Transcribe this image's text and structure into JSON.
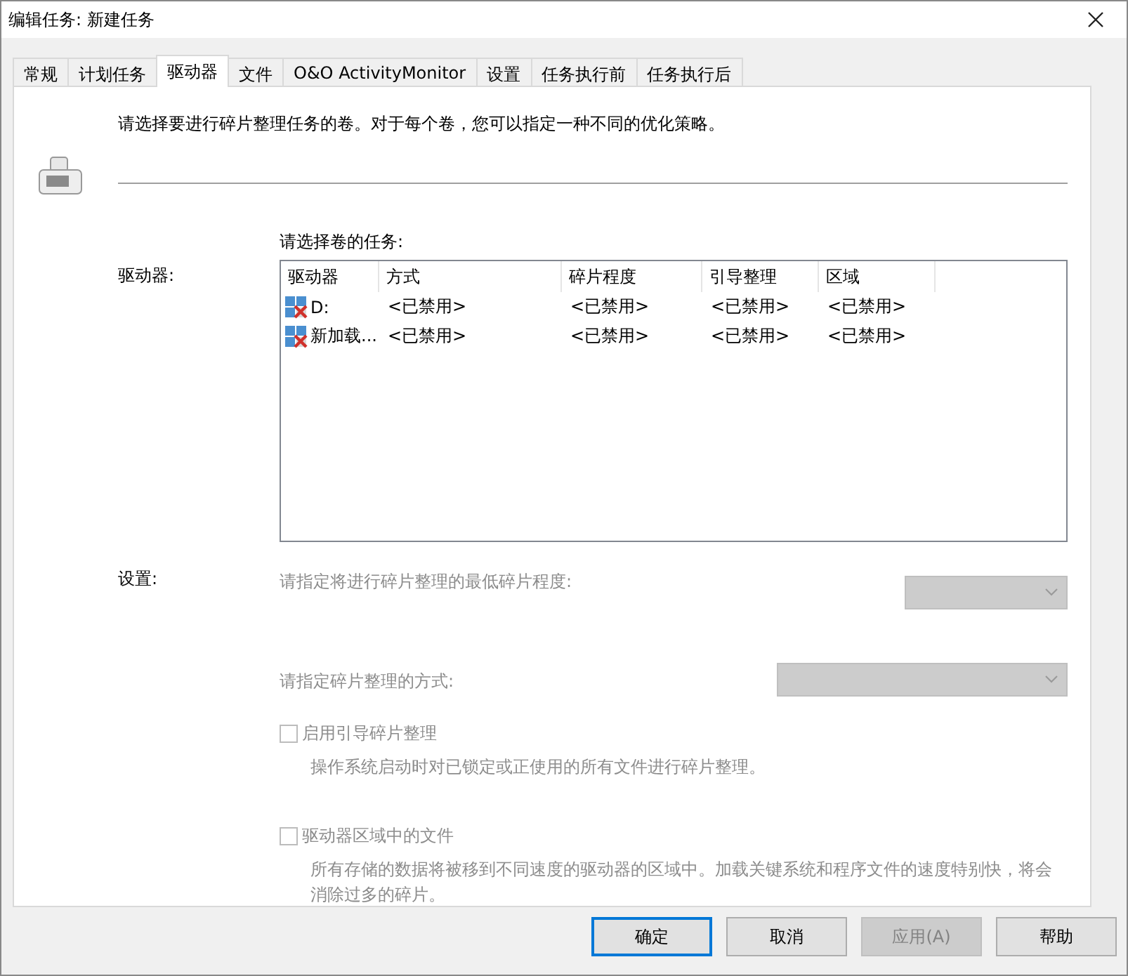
{
  "window": {
    "title": "编辑任务: 新建任务"
  },
  "tabs": [
    {
      "label": "常规",
      "selected": false
    },
    {
      "label": "计划任务",
      "selected": false
    },
    {
      "label": "驱动器",
      "selected": true
    },
    {
      "label": "文件",
      "selected": false
    },
    {
      "label": "O&O ActivityMonitor",
      "selected": false
    },
    {
      "label": "设置",
      "selected": false
    },
    {
      "label": "任务执行前",
      "selected": false
    },
    {
      "label": "任务执行后",
      "selected": false
    }
  ],
  "intro": "请选择要进行碎片整理任务的卷。对于每个卷，您可以指定一种不同的优化策略。",
  "drives_label": "驱动器:",
  "list_caption": "请选择卷的任务:",
  "table": {
    "columns": [
      "驱动器",
      "方式",
      "碎片程度",
      "引导整理",
      "区域"
    ],
    "rows": [
      {
        "cells": [
          "D:",
          "<已禁用>",
          "<已禁用>",
          "<已禁用>",
          "<已禁用>"
        ]
      },
      {
        "cells": [
          "新加载...",
          "<已禁用>",
          "<已禁用>",
          "<已禁用>",
          "<已禁用>"
        ]
      }
    ]
  },
  "settings_label": "设置:",
  "settings": [
    {
      "kind": "dropdown",
      "label": "请指定将进行碎片整理的最低碎片程度:",
      "disabled": true
    },
    {
      "kind": "dropdown",
      "label": "请指定碎片整理的方式:",
      "disabled": true
    },
    {
      "kind": "checkbox",
      "label": "启用引导碎片整理",
      "description": "操作系统启动时对已锁定或正使用的所有文件进行碎片整理。",
      "checked": false,
      "disabled": true
    },
    {
      "kind": "checkbox",
      "label": "驱动器区域中的文件",
      "description": "所有存储的数据将被移到不同速度的驱动器的区域中。加载关键系统和程序文件的速度特别快，将会消除过多的碎片。",
      "checked": false,
      "disabled": true
    }
  ],
  "buttons": [
    {
      "label": "确定",
      "default": true,
      "disabled": false
    },
    {
      "label": "取消",
      "default": false,
      "disabled": false
    },
    {
      "label": "应用(A)",
      "default": false,
      "disabled": true
    },
    {
      "label": "帮助",
      "default": false,
      "disabled": false
    }
  ]
}
